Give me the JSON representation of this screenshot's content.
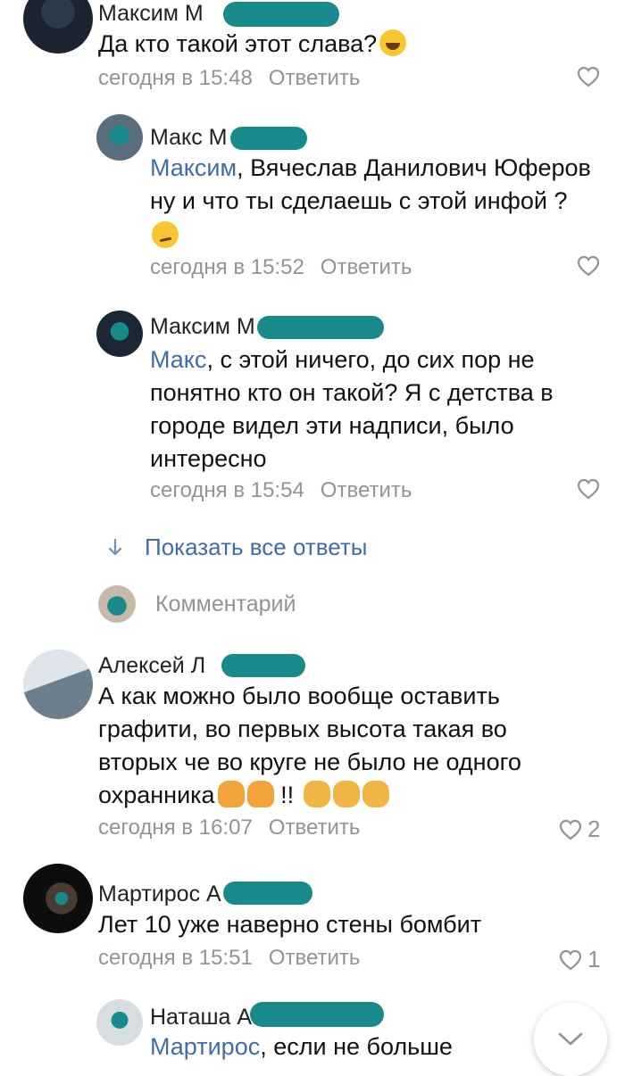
{
  "comments": [
    {
      "author": "Максим М",
      "text_parts": [
        "Да кто такой этот слава?"
      ],
      "time": "сегодня в 15:48",
      "reply_label": "Ответить",
      "likes": ""
    },
    {
      "author": "Макс М",
      "mention": "Максим",
      "text": ", Вячеслав Данилович Юферов ну и что ты сделаешь с этой инфой ?",
      "time": "сегодня в 15:52",
      "reply_label": "Ответить",
      "likes": ""
    },
    {
      "author": "Максим М",
      "mention": "Макс",
      "text": ", с этой ничего, до сих пор не понятно кто он такой? Я с детства в городе видел эти надписи, было интересно",
      "time": "сегодня в 15:54",
      "reply_label": "Ответить",
      "likes": ""
    },
    {
      "author": "Алексей Л",
      "text": "А как можно было вообще оставить графити, во первых высота такая во вторых че во круге не было не одного охранника",
      "text_tail": "!!",
      "time": "сегодня в 16:07",
      "reply_label": "Ответить",
      "likes": "2"
    },
    {
      "author": "Мартирос А",
      "text": "Лет 10 уже наверно стены бомбит",
      "time": "сегодня в 15:51",
      "reply_label": "Ответить",
      "likes": "1"
    },
    {
      "author": "Наташа А",
      "mention": "Мартирос",
      "text": ", если не больше"
    }
  ],
  "show_all_label": "Показать все ответы",
  "comment_placeholder": "Комментарий",
  "icons": {
    "like": "heart-outline-icon",
    "show_all": "arrow-down-icon",
    "scroll": "chevron-down-icon"
  },
  "colors": {
    "link": "#3f6ea5",
    "meta": "#8f9499",
    "redaction": "#198a8c"
  }
}
